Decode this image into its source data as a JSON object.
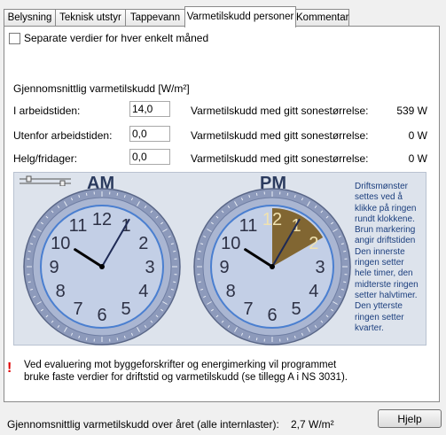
{
  "tabs": [
    "Belysning",
    "Teknisk utstyr",
    "Tappevann",
    "Varmetilskudd personer",
    "Kommentar"
  ],
  "active_tab": 3,
  "separate_checkbox": {
    "label": "Separate verdier for hver enkelt måned",
    "checked": false
  },
  "section_title": "Gjennomsnittlig varmetilskudd [W/m²]",
  "rows": [
    {
      "label": "I arbeidstiden:",
      "value": "14,0",
      "result_label": "Varmetilskudd med gitt sonestørrelse:",
      "result_value": "539 W"
    },
    {
      "label": "Utenfor arbeidstiden:",
      "value": "0,0",
      "result_label": "Varmetilskudd med gitt sonestørrelse:",
      "result_value": "0 W"
    },
    {
      "label": "Helg/fridager:",
      "value": "0,0",
      "result_label": "Varmetilskudd med gitt sonestørrelse:",
      "result_value": "0 W"
    }
  ],
  "clocks": {
    "am_label": "AM",
    "pm_label": "PM",
    "numbers": [
      "12",
      "1",
      "2",
      "3",
      "4",
      "5",
      "6",
      "7",
      "8",
      "9",
      "10",
      "11"
    ],
    "time_hour": 10,
    "time_minute": 5,
    "pm_active_hours": [
      0,
      2
    ],
    "colors": {
      "face": "#c3cfe6",
      "ring": "#7b8aaa",
      "active": "#7a5a1e"
    }
  },
  "description": "Driftsmønster settes ved å klikke på ringen rundt klokkene. Brun markering angir driftstiden Den innerste ringen setter hele timer, den midterste ringen setter halvtimer. Den ytterste ringen setter kvarter.",
  "warning": "Ved evaluering mot byggeforskrifter og energimerking vil programmet bruke faste verdier for driftstid og varmetilskudd (se tillegg A i NS 3031).",
  "footer": {
    "label": "Gjennomsnittlig varmetilskudd over året (alle internlaster):",
    "value": "2,7 W/m²",
    "help_button": "Hjelp"
  }
}
